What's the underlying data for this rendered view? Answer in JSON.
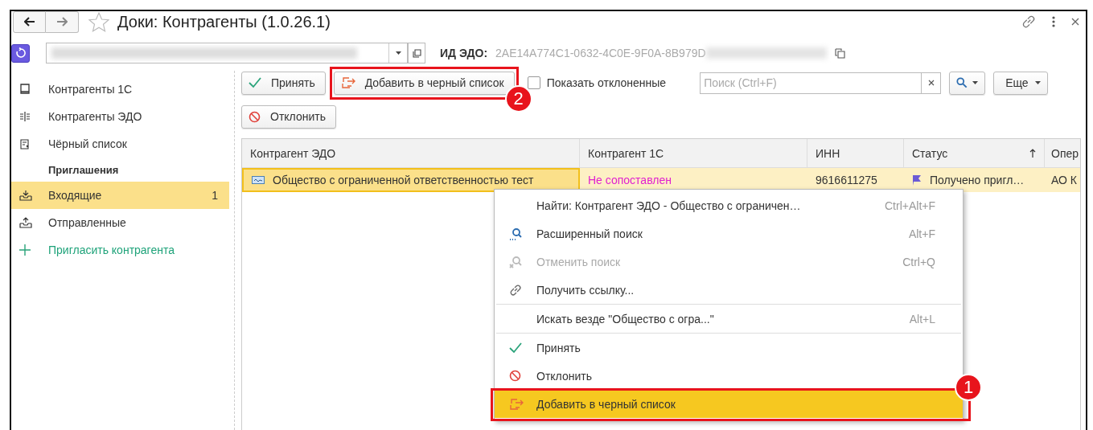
{
  "window": {
    "title": "Доки: Контрагенты (1.0.26.1)"
  },
  "header": {
    "edo_id_label": "ИД ЭДО:",
    "edo_id_value": "2AE14A774C1-0632-4C0E-9F0A-8B979D"
  },
  "sidebar": {
    "items": [
      {
        "kind": "nav",
        "label": "Контрагенты 1С",
        "selected": false
      },
      {
        "kind": "nav",
        "label": "Контрагенты ЭДО",
        "selected": false
      },
      {
        "kind": "nav",
        "label": "Чёрный список",
        "selected": false
      },
      {
        "kind": "heading",
        "label": "Приглашения"
      },
      {
        "kind": "nav",
        "label": "Входящие",
        "count": "1",
        "selected": true
      },
      {
        "kind": "nav",
        "label": "Отправленные",
        "selected": false
      },
      {
        "kind": "action",
        "label": "Пригласить контрагента"
      }
    ]
  },
  "toolbar": {
    "accept": "Принять",
    "blacklist": {
      "label": "Добавить в черный список",
      "callout": "2"
    },
    "show_rejected": {
      "label": "Показать отклоненные",
      "checked": false
    },
    "search": {
      "placeholder": "Поиск (Ctrl+F)"
    },
    "more": "Еще",
    "reject": "Отклонить"
  },
  "table": {
    "columns": [
      {
        "label": "Контрагент ЭДО",
        "sorted": false
      },
      {
        "label": "Контрагент 1С",
        "sorted": false
      },
      {
        "label": "ИНН",
        "sorted": false
      },
      {
        "label": "Статус",
        "sorted": true
      },
      {
        "label": "Опер",
        "sorted": false
      }
    ],
    "rows": [
      {
        "selected": true,
        "matched": false,
        "cells": [
          "Общество с ограниченной ответственностью  тест",
          "Не сопоставлен",
          "9616611275",
          "Получено пригл…",
          "АО К"
        ]
      }
    ]
  },
  "context_menu": {
    "items": [
      {
        "kind": "item",
        "label": "Найти: Контрагент ЭДО - Общество с ограничен…",
        "shortcut": "Ctrl+Alt+F",
        "disabled": false,
        "selected": false
      },
      {
        "kind": "item",
        "label": "Расширенный поиск",
        "shortcut": "Alt+F",
        "disabled": false,
        "selected": false
      },
      {
        "kind": "item",
        "label": "Отменить поиск",
        "shortcut": "Ctrl+Q",
        "disabled": true,
        "selected": false
      },
      {
        "kind": "item",
        "label": "Получить ссылку...",
        "disabled": false,
        "selected": false
      },
      {
        "kind": "separator"
      },
      {
        "kind": "item",
        "label": "Искать везде \"Общество с огра...\"",
        "shortcut": "Alt+L",
        "disabled": false,
        "selected": false
      },
      {
        "kind": "separator"
      },
      {
        "kind": "item",
        "label": "Принять",
        "disabled": false,
        "selected": false
      },
      {
        "kind": "item",
        "label": "Отклонить",
        "disabled": false,
        "selected": false
      },
      {
        "kind": "item",
        "label": "Добавить в черный список",
        "disabled": false,
        "selected": true,
        "callout": "1"
      }
    ]
  }
}
